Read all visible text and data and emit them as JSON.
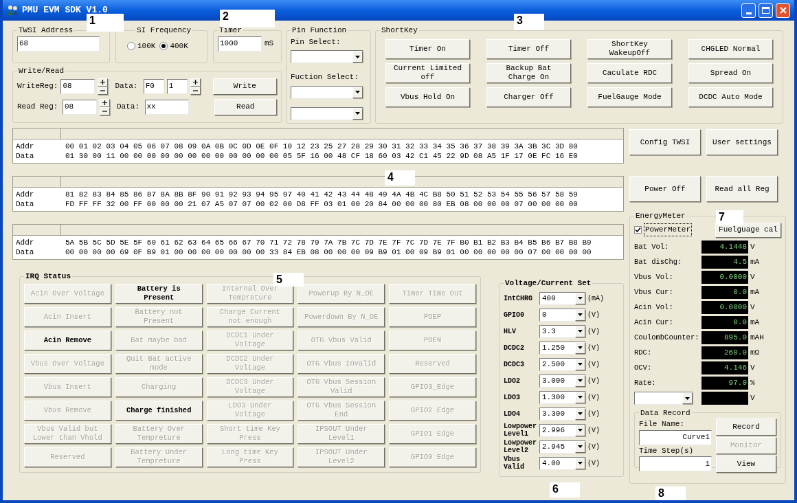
{
  "window": {
    "title": "PMU EVM SDK V1.0"
  },
  "callouts": [
    {
      "label": "1"
    },
    {
      "label": "2"
    },
    {
      "label": "3"
    },
    {
      "label": "4"
    },
    {
      "label": "5"
    },
    {
      "label": "6"
    },
    {
      "label": "7"
    },
    {
      "label": "8"
    }
  ],
  "twsi_address": {
    "label": "TWSI Address",
    "value": "68"
  },
  "twsi_frequency": {
    "label": "SI Frequency",
    "options": [
      {
        "label": "100K",
        "selected": false
      },
      {
        "label": "400K",
        "selected": true
      }
    ]
  },
  "timer": {
    "label": "Timer",
    "value": "1000",
    "unit": "mS"
  },
  "write_read": {
    "label": "Write/Read",
    "write_reg_label": "WriteReg:",
    "write_reg": "08",
    "write_data_label": "Data:",
    "write_data": "F0",
    "write_count": "1",
    "write_button": "Write",
    "read_reg_label": "Read Reg:",
    "read_reg": "08",
    "read_data_label": "Data:",
    "read_data": "xx",
    "read_button": "Read"
  },
  "pin_function": {
    "label": "Pin Function",
    "pin_select_label": "Pin Select:",
    "function_select_label": "Fuction Select:"
  },
  "shortkey": {
    "label": "ShortKey",
    "buttons": [
      "Timer On",
      "Timer Off",
      "ShortKey\nWakeupOff",
      "CHGLED Normal",
      "Current Limited\noff",
      "Backup Bat\nCharge On",
      "Caculate RDC",
      "Spread On",
      "Vbus Hold On",
      "Charger Off",
      "FuelGauge Mode",
      "DCDC Auto Mode"
    ]
  },
  "hex_tables": [
    {
      "addr_label": "Addr",
      "addr": "00 01 02 03 04 05 06 07 08 09 0A 0B 0C 0D 0E 0F 10 12 23 25 27 28 29 30 31 32 33 34 35 36 37 38 39 3A 3B 3C 3D 80",
      "data_label": "Data",
      "data": "01 30 00 11 00 00 00 00 00 00 00 00 00 00 00 00 05 5F 16 00 48 CF 18 60 03 42 C1 45 22 9D 08 A5 1F 17 0E FC 16 E0"
    },
    {
      "addr_label": "Addr",
      "addr": "81 82 83 84 85 86 87 8A 8B 8F 90 91 92 93 94 95 97 40 41 42 43 44 48 49 4A 4B 4C B8 50 51 52 53 54 55 56 57 58 59",
      "data_label": "Data",
      "data": "FD FF FF 32 00 FF 00 00 00 21 07 A5 07 07 00 02 00 D8 FF 03 01 00 20 84 00 00 00 80 EB 08 00 00 00 07 00 00 00 00"
    },
    {
      "addr_label": "Addr",
      "addr": "5A 5B 5C 5D 5E 5F 60 61 62 63 64 65 66 67 70 71 72 78 79 7A 7B 7C 7D 7E 7F 7C 7D 7E 7F B0 B1 B2 B3 B4 B5 B6 B7 B8 B9",
      "data_label": "Data",
      "data": "00 00 00 00 69 0F B9 01 00 00 00 00 00 00 00 33 84 EB 08 00 00 00 09 B9 01 00 09 B9 01 00 00 00 00 00 07 00 00 00 00"
    }
  ],
  "right_buttons": [
    "Config TWSI",
    "User settings",
    "Power Off",
    "Read all Reg"
  ],
  "irq_status": {
    "label": "IRQ Status",
    "items": [
      {
        "label": "Acin Over Voltage",
        "active": false
      },
      {
        "label": "Battery is\nPresent",
        "active": true
      },
      {
        "label": "Internal Over\nTempreture",
        "active": false
      },
      {
        "label": "Powerup By N_OE",
        "active": false
      },
      {
        "label": "Timer Time Out",
        "active": false
      },
      {
        "label": "Acin Insert",
        "active": false
      },
      {
        "label": "Battery not\nPresent",
        "active": false
      },
      {
        "label": "Charge Current\nnot enough",
        "active": false
      },
      {
        "label": "Powerdown By N_OE",
        "active": false
      },
      {
        "label": "POEP",
        "active": false
      },
      {
        "label": "Acin Remove",
        "active": true
      },
      {
        "label": "Bat maybe bad",
        "active": false
      },
      {
        "label": "DCDC1 Under\nVoltage",
        "active": false
      },
      {
        "label": "OTG Vbus Valid",
        "active": false
      },
      {
        "label": "POEN",
        "active": false
      },
      {
        "label": "Vbus Over Voltage",
        "active": false
      },
      {
        "label": "Quit Bat active\nmode",
        "active": false
      },
      {
        "label": "DCDC2 Under\nVoltage",
        "active": false
      },
      {
        "label": "OTG Vbus Invalid",
        "active": false
      },
      {
        "label": "Reserved",
        "active": false
      },
      {
        "label": "Vbus Insert",
        "active": false
      },
      {
        "label": "Charging",
        "active": false
      },
      {
        "label": "DCDC3 Under\nVoltage",
        "active": false
      },
      {
        "label": "OTG Vbus Session\nValid",
        "active": false
      },
      {
        "label": "GPIO3_Edge",
        "active": false
      },
      {
        "label": "Vbus Remove",
        "active": false
      },
      {
        "label": "Charge finished",
        "active": true
      },
      {
        "label": "LDO3 Under\nVoltage",
        "active": false
      },
      {
        "label": "OTG Vbus Session\nEnd",
        "active": false
      },
      {
        "label": "GPIO2 Edge",
        "active": false
      },
      {
        "label": "Vbus Valid but\nLower than Vhold",
        "active": false
      },
      {
        "label": "Battery Over\nTempreture",
        "active": false
      },
      {
        "label": "Short time Key\nPress",
        "active": false
      },
      {
        "label": "IPSOUT Under\nLevel1",
        "active": false
      },
      {
        "label": "GPIO1 Edge",
        "active": false
      },
      {
        "label": "Reserved",
        "active": false
      },
      {
        "label": "Battery Under\nTempreture",
        "active": false
      },
      {
        "label": "Long time Key\nPress",
        "active": false
      },
      {
        "label": "IPSOUT Under\nLevel2",
        "active": false
      },
      {
        "label": "GPIO0 Edge",
        "active": false
      }
    ]
  },
  "voltage_current_set": {
    "label": "Voltage/Current Set",
    "rows": [
      {
        "label": "IntCHRG",
        "value": "400",
        "unit": "(mA)"
      },
      {
        "label": "GPIO0",
        "value": "0",
        "unit": "(V)"
      },
      {
        "label": "HLV",
        "value": "3.3",
        "unit": "(V)"
      },
      {
        "label": "DCDC2",
        "value": "1.250",
        "unit": "(V)"
      },
      {
        "label": "DCDC3",
        "value": "2.500",
        "unit": "(V)"
      },
      {
        "label": "LDO2",
        "value": "3.000",
        "unit": "(V)"
      },
      {
        "label": "LDO3",
        "value": "1.300",
        "unit": "(V)"
      },
      {
        "label": "LDO4",
        "value": "3.300",
        "unit": "(V)"
      },
      {
        "label": "Lowpower\nLevel1",
        "value": "2.996",
        "unit": "(V)"
      },
      {
        "label": "Lowpower\nLevel2",
        "value": "2.945",
        "unit": "(V)"
      },
      {
        "label": "Vbus\nValid",
        "value": "4.00",
        "unit": "(V)"
      }
    ]
  },
  "energy_meter": {
    "label": "EnergyMeter",
    "power_meter": {
      "label": "PowerMeter",
      "checked": true
    },
    "fuelgauge_button": "Fuelguage cal",
    "readings": [
      {
        "kind": "label",
        "label": "Bat Vol:",
        "value": "4.1448",
        "unit": "V"
      },
      {
        "kind": "label",
        "label": "Bat disChg:",
        "value": "4.5",
        "unit": "mA"
      },
      {
        "kind": "label",
        "label": "Vbus Vol:",
        "value": "0.0000",
        "unit": "V"
      },
      {
        "kind": "label",
        "label": "Vbus Cur:",
        "value": "0.0",
        "unit": "mA"
      },
      {
        "kind": "label",
        "label": "Acin Vol:",
        "value": "0.0000",
        "unit": "V"
      },
      {
        "kind": "label",
        "label": "Acin Cur:",
        "value": "0.0",
        "unit": "mA"
      },
      {
        "kind": "label",
        "label": "CoulombCounter:",
        "value": "895.0",
        "unit": "mAH"
      },
      {
        "kind": "label",
        "label": "RDC:",
        "value": "260.0",
        "unit": "mΩ"
      },
      {
        "kind": "label",
        "label": "OCV:",
        "value": "4.146",
        "unit": "V"
      },
      {
        "kind": "label",
        "label": "Rate:",
        "value": "97.0",
        "unit": "%"
      },
      {
        "kind": "select",
        "unit": "V"
      }
    ]
  },
  "data_record": {
    "label": "Data Record",
    "file_name_label": "File Name:",
    "file_name": "Curve1",
    "time_step_label": "Time Step(s)",
    "time_step": "1",
    "buttons": [
      {
        "label": "Record",
        "disabled": false
      },
      {
        "label": "Monitor",
        "disabled": true
      },
      {
        "label": "View",
        "disabled": false
      }
    ]
  }
}
